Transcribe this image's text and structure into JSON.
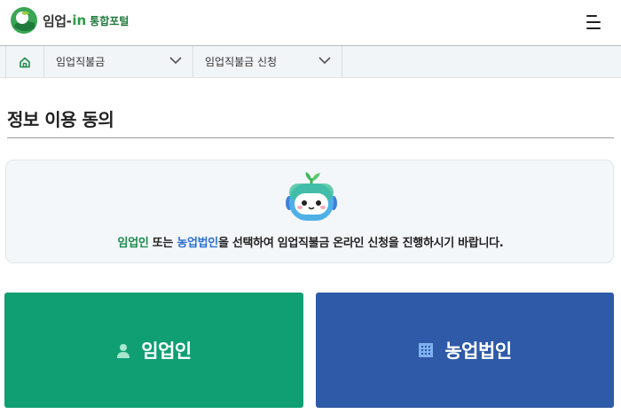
{
  "header": {
    "logo_main": "임업-",
    "logo_in": "in",
    "logo_sub": "통합포털",
    "menu_icon": "hamburger-icon"
  },
  "breadcrumb": {
    "home_icon": "home-icon",
    "level1": "임업직불금",
    "level2": "임업직불금 신청"
  },
  "page": {
    "title": "정보 이용 동의"
  },
  "notice": {
    "part1": "임업인",
    "part2": " 또는 ",
    "part3": "농업법인",
    "part4": "을 선택하여 임업직불금 온라인 신청을 진행하시기 바랍니다."
  },
  "choices": {
    "forester_label": "임업인",
    "forester_icon": "person-icon",
    "corp_label": "농업법인",
    "corp_icon": "building-icon"
  },
  "colors": {
    "forester_bg": "#0f9f73",
    "corp_bg": "#2f5aa7",
    "highlight_green": "#1a8a4a",
    "highlight_blue": "#2b6fd3"
  }
}
